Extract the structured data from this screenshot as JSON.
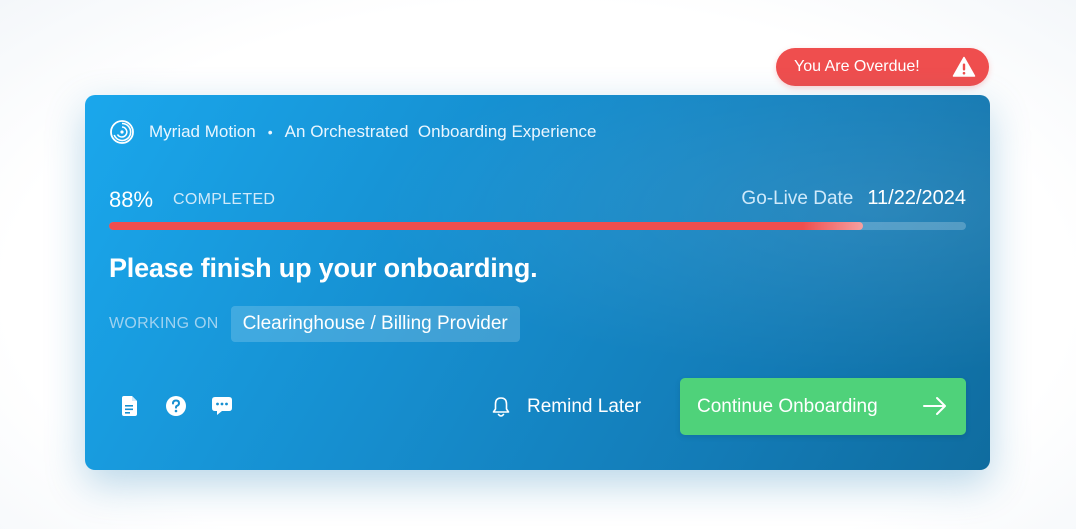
{
  "overdue_badge": {
    "label": "You Are Overdue!",
    "icon": "warning-triangle-icon",
    "color": "#ef4e4e"
  },
  "brand": {
    "logo_icon": "myriad-motion-logo-icon",
    "name": "Myriad Motion",
    "separator": "•",
    "tagline": "An Orchestrated  Onboarding Experience"
  },
  "progress": {
    "percent_text": "88%",
    "percent_value": 0.88,
    "label": "COMPLETED",
    "fill_color": "#ef4e4e"
  },
  "go_live": {
    "label": "Go-Live Date",
    "date": "11/22/2024"
  },
  "headline": "Please finish up your onboarding.",
  "working_on": {
    "label": "WORKING ON",
    "value": "Clearinghouse / Billing Provider"
  },
  "tools": [
    {
      "icon": "document-icon"
    },
    {
      "icon": "help-icon"
    },
    {
      "icon": "chat-icon"
    }
  ],
  "remind": {
    "icon": "bell-icon",
    "label": "Remind Later"
  },
  "continue_button": {
    "label": "Continue Onboarding",
    "icon": "arrow-right-icon",
    "color": "#4fd27a"
  },
  "card_colors": {
    "gradient_start": "#1aa7ec",
    "gradient_end": "#0f6c9f"
  }
}
